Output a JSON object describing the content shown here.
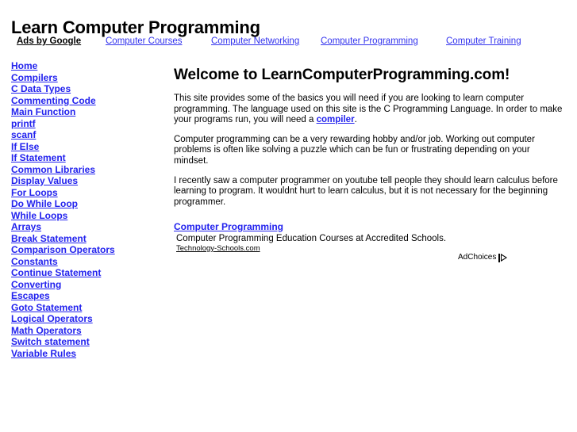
{
  "page": {
    "site_title": "Learn Computer Programming",
    "link_color": "#2222ee",
    "text_color": "#000000",
    "background": "#ffffff"
  },
  "ads_bar": {
    "label": "Ads by Google",
    "links": [
      {
        "label": "Computer Courses"
      },
      {
        "label": "Computer Networking"
      },
      {
        "label": "Computer Programming"
      },
      {
        "label": "Computer Training"
      }
    ]
  },
  "sidebar": {
    "items": [
      {
        "label": "Home"
      },
      {
        "label": "Compilers"
      },
      {
        "label": "C Data Types"
      },
      {
        "label": "Commenting Code"
      },
      {
        "label": "Main Function"
      },
      {
        "label": "printf"
      },
      {
        "label": "scanf"
      },
      {
        "label": "If Else"
      },
      {
        "label": "If Statement"
      },
      {
        "label": "Common Libraries"
      },
      {
        "label": "Display Values"
      },
      {
        "label": "For Loops"
      },
      {
        "label": "Do While Loop"
      },
      {
        "label": "While Loops"
      },
      {
        "label": "Arrays"
      },
      {
        "label": "Break Statement"
      },
      {
        "label": "Comparison Operators"
      },
      {
        "label": "Constants"
      },
      {
        "label": "Continue Statement"
      },
      {
        "label": "Converting"
      },
      {
        "label": "Escapes"
      },
      {
        "label": "Goto Statement"
      },
      {
        "label": "Logical Operators"
      },
      {
        "label": "Math Operators"
      },
      {
        "label": "Switch statement"
      },
      {
        "label": "Variable Rules"
      }
    ]
  },
  "main": {
    "heading": "Welcome to LearnComputerProgramming.com!",
    "paragraph_1_before": "This site provides some of the basics you will need if you are looking to learn computer programming. The language used on this site is the C Programming Language. In order to make your programs run, you will need a ",
    "paragraph_1_link": "compiler",
    "paragraph_1_after": ".",
    "paragraph_2": "Computer programming can be a very rewarding hobby and/or job. Working out computer problems is often like solving a puzzle which can be fun or frustrating depending on your mindset.",
    "paragraph_3": "I recently saw a computer programmer on youtube tell people they should learn calculus before learning to program. It wouldnt hurt to learn calculus, but it is not necessary for the beginning programmer."
  },
  "ad_block": {
    "title": "Computer Programming",
    "description": "Computer Programming Education Courses at Accredited Schools.",
    "url": "Technology-Schools.com"
  },
  "adchoices": {
    "label": "AdChoices",
    "icon": "adchoices-triangle-icon"
  }
}
